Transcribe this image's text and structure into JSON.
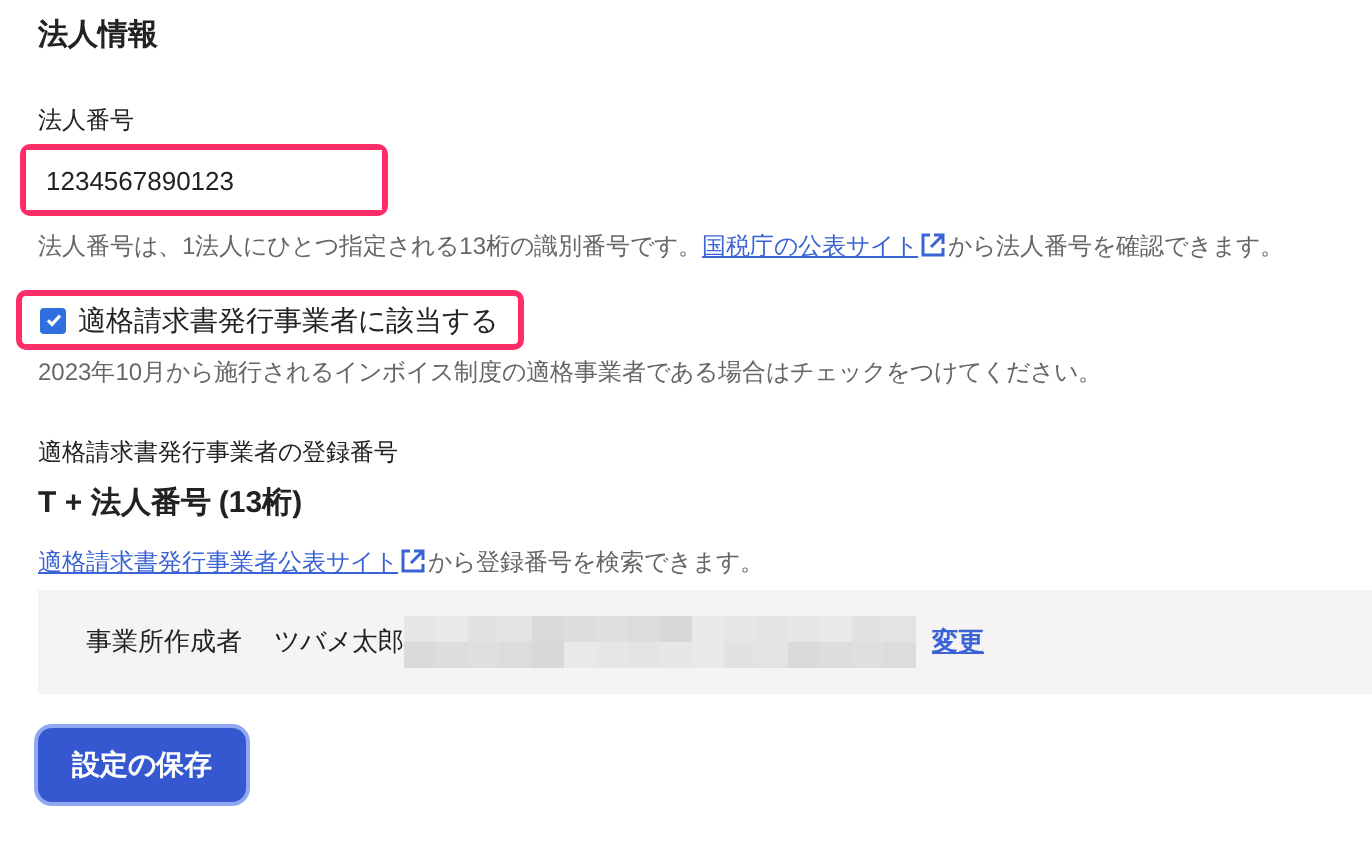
{
  "title": "法人情報",
  "corporate_number": {
    "label": "法人番号",
    "value": "1234567890123",
    "highlighted": true,
    "help_before": "法人番号は、1法人にひとつ指定される13桁の識別番号です。",
    "help_link": "国税庁の公表サイト",
    "help_after": "から法人番号を確認できます。"
  },
  "invoice_issuer": {
    "label": "適格請求書発行事業者に該当する",
    "checked": true,
    "highlighted": true,
    "help": "2023年10月から施行されるインボイス制度の適格事業者である場合はチェックをつけてください。"
  },
  "registration": {
    "label": "適格請求書発行事業者の登録番号",
    "value": "T + 法人番号 (13桁)",
    "help_link": "適格請求書発行事業者公表サイト",
    "help_after": "から登録番号を検索できます。"
  },
  "creator": {
    "label": "事業所作成者",
    "name": "ツバメ太郎",
    "redacted": true,
    "action": "変更"
  },
  "save_button": "設定の保存"
}
